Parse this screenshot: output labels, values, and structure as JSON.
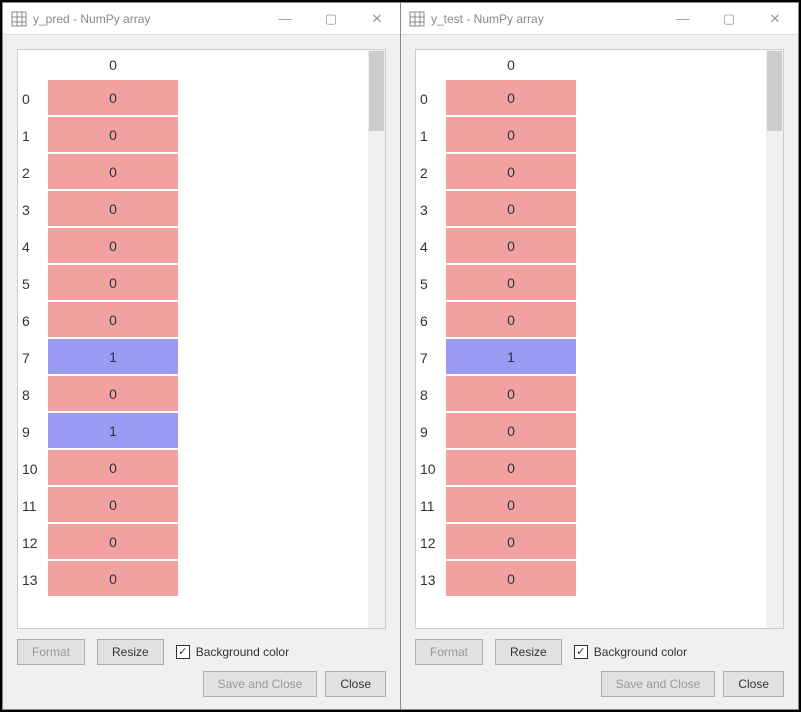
{
  "panels": [
    {
      "title": "y_pred - NumPy array",
      "col_header": "0",
      "rows": [
        {
          "idx": "0",
          "val": "0",
          "cls": "v0"
        },
        {
          "idx": "1",
          "val": "0",
          "cls": "v0"
        },
        {
          "idx": "2",
          "val": "0",
          "cls": "v0"
        },
        {
          "idx": "3",
          "val": "0",
          "cls": "v0"
        },
        {
          "idx": "4",
          "val": "0",
          "cls": "v0"
        },
        {
          "idx": "5",
          "val": "0",
          "cls": "v0"
        },
        {
          "idx": "6",
          "val": "0",
          "cls": "v0"
        },
        {
          "idx": "7",
          "val": "1",
          "cls": "v1"
        },
        {
          "idx": "8",
          "val": "0",
          "cls": "v0"
        },
        {
          "idx": "9",
          "val": "1",
          "cls": "v1"
        },
        {
          "idx": "10",
          "val": "0",
          "cls": "v0"
        },
        {
          "idx": "11",
          "val": "0",
          "cls": "v0"
        },
        {
          "idx": "12",
          "val": "0",
          "cls": "v0"
        },
        {
          "idx": "13",
          "val": "0",
          "cls": "v0"
        }
      ]
    },
    {
      "title": "y_test - NumPy array",
      "col_header": "0",
      "rows": [
        {
          "idx": "0",
          "val": "0",
          "cls": "v0"
        },
        {
          "idx": "1",
          "val": "0",
          "cls": "v0"
        },
        {
          "idx": "2",
          "val": "0",
          "cls": "v0"
        },
        {
          "idx": "3",
          "val": "0",
          "cls": "v0"
        },
        {
          "idx": "4",
          "val": "0",
          "cls": "v0"
        },
        {
          "idx": "5",
          "val": "0",
          "cls": "v0"
        },
        {
          "idx": "6",
          "val": "0",
          "cls": "v0"
        },
        {
          "idx": "7",
          "val": "1",
          "cls": "v1"
        },
        {
          "idx": "8",
          "val": "0",
          "cls": "v0"
        },
        {
          "idx": "9",
          "val": "0",
          "cls": "v0"
        },
        {
          "idx": "10",
          "val": "0",
          "cls": "v0"
        },
        {
          "idx": "11",
          "val": "0",
          "cls": "v0"
        },
        {
          "idx": "12",
          "val": "0",
          "cls": "v0"
        },
        {
          "idx": "13",
          "val": "0",
          "cls": "v0"
        }
      ]
    }
  ],
  "buttons": {
    "format": "Format",
    "resize": "Resize",
    "bg_color": "Background color",
    "save_close": "Save and Close",
    "close": "Close"
  },
  "checkmark": "✓"
}
